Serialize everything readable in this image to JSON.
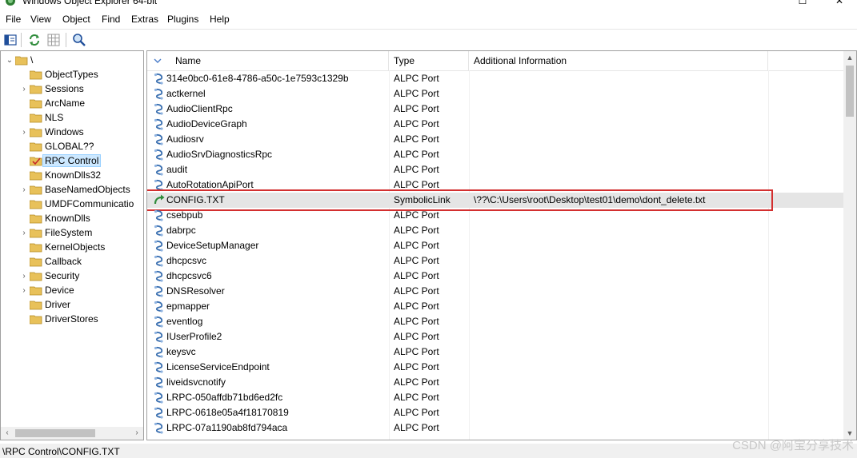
{
  "window": {
    "title": "Windows Object Explorer 64-bit",
    "maximize_glyph": "☐",
    "close_glyph": "✕"
  },
  "menu": [
    "File",
    "View",
    "Object",
    "Find",
    "Extras",
    "Plugins",
    "Help"
  ],
  "tree": {
    "root_label": "\\",
    "items": [
      {
        "label": "ObjectTypes",
        "expandable": false
      },
      {
        "label": "Sessions",
        "expandable": true
      },
      {
        "label": "ArcName",
        "expandable": false
      },
      {
        "label": "NLS",
        "expandable": false
      },
      {
        "label": "Windows",
        "expandable": true
      },
      {
        "label": "GLOBAL??",
        "expandable": false
      },
      {
        "label": "RPC Control",
        "expandable": false,
        "selected": true
      },
      {
        "label": "KnownDlls32",
        "expandable": false
      },
      {
        "label": "BaseNamedObjects",
        "expandable": true
      },
      {
        "label": "UMDFCommunicatio",
        "expandable": false
      },
      {
        "label": "KnownDlls",
        "expandable": false
      },
      {
        "label": "FileSystem",
        "expandable": true
      },
      {
        "label": "KernelObjects",
        "expandable": false
      },
      {
        "label": "Callback",
        "expandable": false
      },
      {
        "label": "Security",
        "expandable": true
      },
      {
        "label": "Device",
        "expandable": true
      },
      {
        "label": "Driver",
        "expandable": false
      },
      {
        "label": "DriverStores",
        "expandable": false
      }
    ]
  },
  "list": {
    "columns": [
      "Name",
      "Type",
      "Additional Information"
    ],
    "rows": [
      {
        "name": "314e0bc0-61e8-4786-a50c-1e7593c1329b",
        "type": "ALPC Port",
        "info": ""
      },
      {
        "name": "actkernel",
        "type": "ALPC Port",
        "info": ""
      },
      {
        "name": "AudioClientRpc",
        "type": "ALPC Port",
        "info": ""
      },
      {
        "name": "AudioDeviceGraph",
        "type": "ALPC Port",
        "info": ""
      },
      {
        "name": "Audiosrv",
        "type": "ALPC Port",
        "info": ""
      },
      {
        "name": "AudioSrvDiagnosticsRpc",
        "type": "ALPC Port",
        "info": ""
      },
      {
        "name": "audit",
        "type": "ALPC Port",
        "info": ""
      },
      {
        "name": "AutoRotationApiPort",
        "type": "ALPC Port",
        "info": ""
      },
      {
        "name": "CONFIG.TXT",
        "type": "SymbolicLink",
        "info": "\\??\\C:\\Users\\root\\Desktop\\test01\\demo\\dont_delete.txt",
        "selected": true
      },
      {
        "name": "csebpub",
        "type": "ALPC Port",
        "info": ""
      },
      {
        "name": "dabrpc",
        "type": "ALPC Port",
        "info": ""
      },
      {
        "name": "DeviceSetupManager",
        "type": "ALPC Port",
        "info": ""
      },
      {
        "name": "dhcpcsvc",
        "type": "ALPC Port",
        "info": ""
      },
      {
        "name": "dhcpcsvc6",
        "type": "ALPC Port",
        "info": ""
      },
      {
        "name": "DNSResolver",
        "type": "ALPC Port",
        "info": ""
      },
      {
        "name": "epmapper",
        "type": "ALPC Port",
        "info": ""
      },
      {
        "name": "eventlog",
        "type": "ALPC Port",
        "info": ""
      },
      {
        "name": "IUserProfile2",
        "type": "ALPC Port",
        "info": ""
      },
      {
        "name": "keysvc",
        "type": "ALPC Port",
        "info": ""
      },
      {
        "name": "LicenseServiceEndpoint",
        "type": "ALPC Port",
        "info": ""
      },
      {
        "name": "liveidsvcnotify",
        "type": "ALPC Port",
        "info": ""
      },
      {
        "name": "LRPC-050affdb71bd6ed2fc",
        "type": "ALPC Port",
        "info": ""
      },
      {
        "name": "LRPC-0618e05a4f18170819",
        "type": "ALPC Port",
        "info": ""
      },
      {
        "name": "LRPC-07a1190ab8fd794aca",
        "type": "ALPC Port",
        "info": ""
      }
    ]
  },
  "status": {
    "path": "\\RPC Control\\CONFIG.TXT"
  },
  "watermark": "CSDN @阿宝分享技术",
  "colors": {
    "folder": "#e8c15a",
    "highlight_border": "#d32f2f",
    "selection": "#cce8ff"
  }
}
